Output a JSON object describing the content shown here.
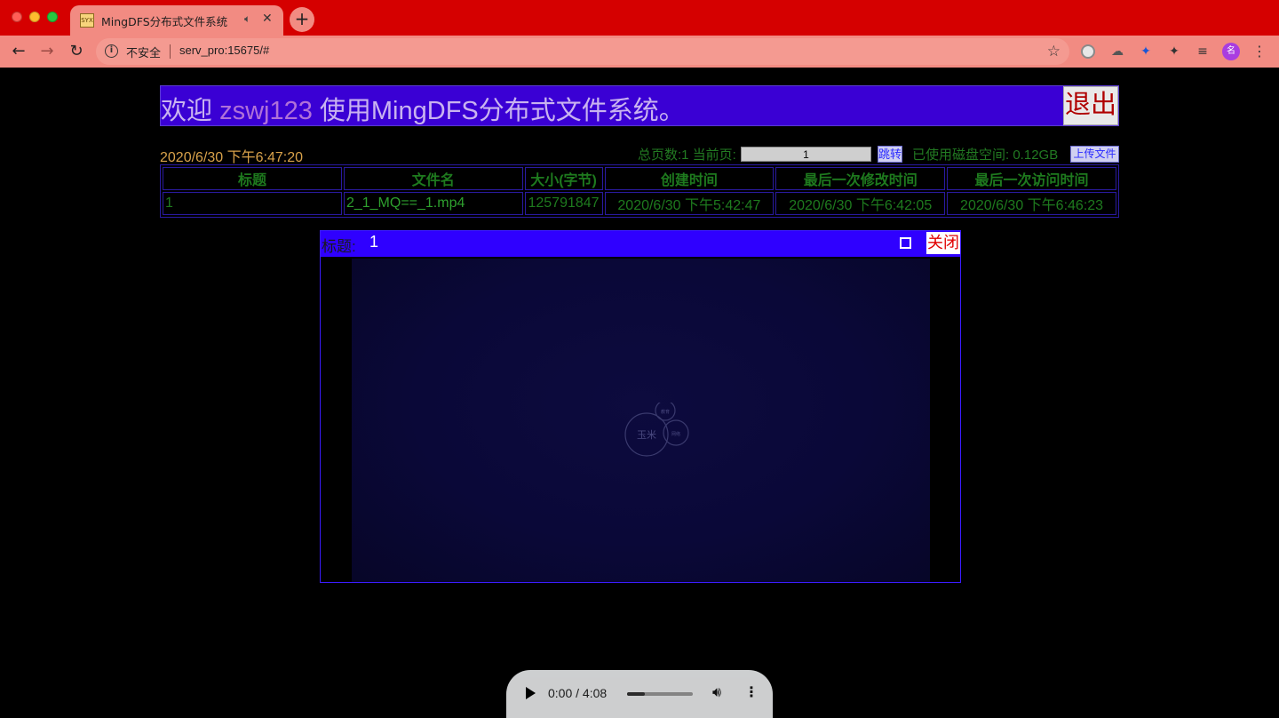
{
  "browser": {
    "tab_title": "MingDFS分布式文件系统",
    "tab_favicon_text": "SYX",
    "security_label": "不安全",
    "url": "serv_pro:15675/#",
    "avatar_letter": "名"
  },
  "header": {
    "welcome_prefix": "欢迎 ",
    "username": "zswj123",
    "welcome_suffix": " 使用MingDFS分布式文件系统。",
    "logout_label": "退出"
  },
  "status": {
    "datetime": "2020/6/30 下午6:47:20",
    "pager_text": "总页数:1 当前页:",
    "current_page": "1",
    "jump_label": "跳转",
    "disk_usage": "已使用磁盘空间: 0.12GB",
    "upload_label": "上传文件"
  },
  "table": {
    "columns": [
      "标题",
      "文件名",
      "大小(字节)",
      "创建时间",
      "最后一次修改时间",
      "最后一次访问时间"
    ],
    "rows": [
      [
        "1",
        "2_1_MQ==_1.mp4",
        "125791847",
        "2020/6/30 下午5:42:47",
        "2020/6/30 下午6:42:05",
        "2020/6/30 下午6:46:23"
      ]
    ]
  },
  "player": {
    "title_label": "标题:",
    "title_value": "1",
    "close_label": "关闭",
    "logo_main": "玉米",
    "logo_small_1": "教育",
    "logo_small_2": "网络"
  },
  "audio": {
    "time": "0:00 / 4:08",
    "progress": 0.27
  },
  "colors": {
    "tabbar": "#d50000",
    "toolbar": "#f28b82",
    "welcome_bg": "#3a00d4",
    "modal_header": "#2f00ff",
    "table_text": "#1e7a1e"
  }
}
